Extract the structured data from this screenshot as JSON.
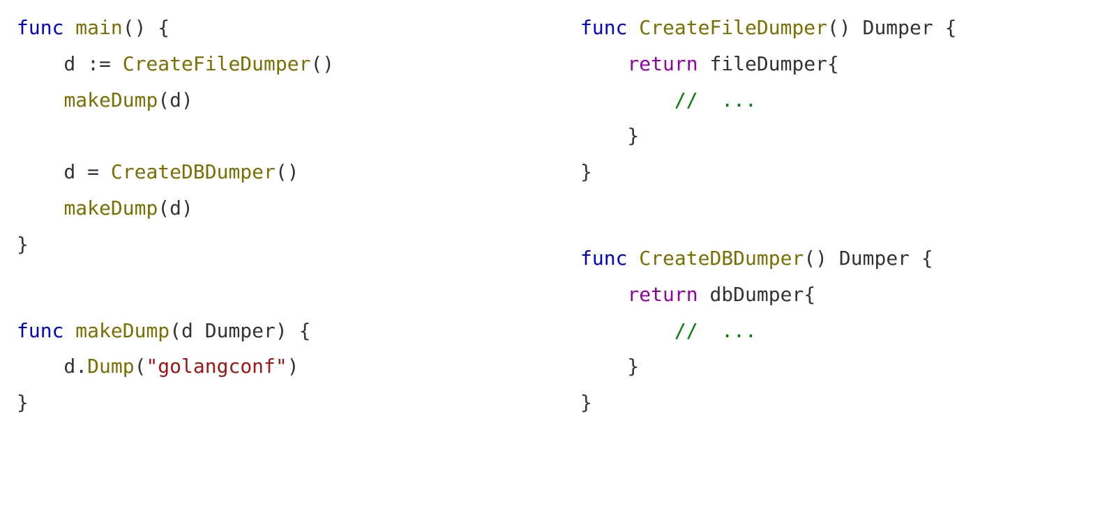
{
  "colors": {
    "keyword": "#0000cc",
    "keyword2": "#9400a8",
    "identifier": "#7a6f00",
    "string": "#a31515",
    "comment": "#008000",
    "default": "#333333"
  },
  "left": {
    "l1": {
      "a": "func ",
      "b": "main",
      "c": "() {"
    },
    "l2": {
      "a": "    d ",
      "b": ":=",
      "c": " ",
      "d": "CreateFileDumper",
      "e": "()"
    },
    "l3": {
      "a": "    ",
      "b": "makeDump",
      "c": "(d)"
    },
    "l4": {
      "a": ""
    },
    "l5": {
      "a": "    d ",
      "b": "=",
      "c": " ",
      "d": "CreateDBDumper",
      "e": "()"
    },
    "l6": {
      "a": "    ",
      "b": "makeDump",
      "c": "(d)"
    },
    "l7": {
      "a": "}"
    },
    "m1": {
      "a": "func ",
      "b": "makeDump",
      "c": "(d Dumper) {"
    },
    "m2": {
      "a": "    d.",
      "b": "Dump",
      "c": "(",
      "d": "\"golangconf\"",
      "e": ")"
    },
    "m3": {
      "a": "}"
    }
  },
  "right": {
    "f1": {
      "a": "func ",
      "b": "CreateFileDumper",
      "c": "() Dumper {"
    },
    "f2": {
      "a": "    ",
      "b": "return ",
      "c": "fileDumper{"
    },
    "f3": {
      "a": "        ",
      "b": "//  ..."
    },
    "f4": {
      "a": "    }"
    },
    "f5": {
      "a": "}"
    },
    "d1": {
      "a": "func ",
      "b": "CreateDBDumper",
      "c": "() Dumper {"
    },
    "d2": {
      "a": "    ",
      "b": "return ",
      "c": "dbDumper{"
    },
    "d3": {
      "a": "        ",
      "b": "//  ..."
    },
    "d4": {
      "a": "    }"
    },
    "d5": {
      "a": "}"
    }
  }
}
